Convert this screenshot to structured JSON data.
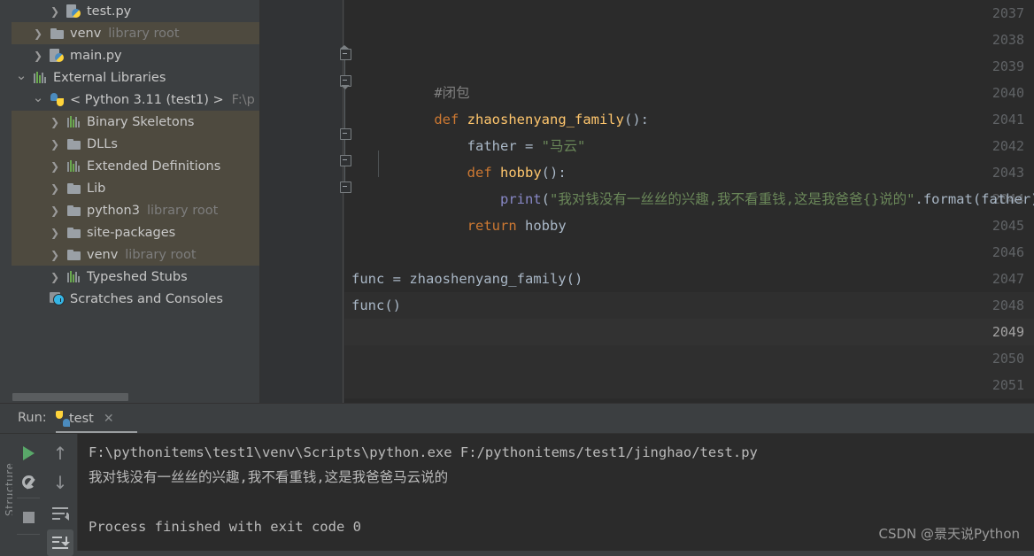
{
  "project_tree": {
    "rows": [
      {
        "label": "test.py",
        "sub": "",
        "icon": "python-file-icon",
        "arrow": "chevron-right",
        "indent": 3,
        "selected": false
      },
      {
        "label": "venv",
        "sub": "library root",
        "icon": "folder-icon",
        "arrow": "chevron-right",
        "indent": 2,
        "selected": true
      },
      {
        "label": "main.py",
        "sub": "",
        "icon": "python-file-icon",
        "arrow": "chevron-right",
        "indent": 2,
        "selected": false
      },
      {
        "label": "External Libraries",
        "sub": "",
        "icon": "library-icon",
        "arrow": "chevron-down",
        "indent": 1,
        "selected": false
      },
      {
        "label": "< Python 3.11 (test1) >",
        "sub": "",
        "path": "F:\\p",
        "icon": "python-icon",
        "arrow": "chevron-down",
        "indent": 2,
        "selected": false
      },
      {
        "label": "Binary Skeletons",
        "sub": "",
        "icon": "library-icon",
        "arrow": "chevron-right",
        "indent": 3,
        "selected": true
      },
      {
        "label": "DLLs",
        "sub": "",
        "icon": "folder-icon",
        "arrow": "chevron-right",
        "indent": 3,
        "selected": true
      },
      {
        "label": "Extended Definitions",
        "sub": "",
        "icon": "library-icon",
        "arrow": "chevron-right",
        "indent": 3,
        "selected": true
      },
      {
        "label": "Lib",
        "sub": "",
        "icon": "folder-icon",
        "arrow": "chevron-right",
        "indent": 3,
        "selected": true
      },
      {
        "label": "python3",
        "sub": "library root",
        "icon": "folder-icon",
        "arrow": "chevron-right",
        "indent": 3,
        "selected": true
      },
      {
        "label": "site-packages",
        "sub": "",
        "icon": "folder-icon",
        "arrow": "chevron-right",
        "indent": 3,
        "selected": true
      },
      {
        "label": "venv",
        "sub": "library root",
        "icon": "folder-icon",
        "arrow": "chevron-right",
        "indent": 3,
        "selected": true
      },
      {
        "label": "Typeshed Stubs",
        "sub": "",
        "icon": "library-icon",
        "arrow": "chevron-right",
        "indent": 3,
        "selected": false
      },
      {
        "label": "Scratches and Consoles",
        "sub": "",
        "icon": "scratches-icon",
        "arrow": "none",
        "indent": 2,
        "selected": false
      }
    ]
  },
  "editor": {
    "current_line": 2049,
    "lines": [
      {
        "num": 2037,
        "text": ""
      },
      {
        "num": 2038,
        "text": ""
      },
      {
        "num": 2039,
        "text": "#闭包"
      },
      {
        "num": 2040,
        "text": "def zhaoshenyang_family():"
      },
      {
        "num": 2041,
        "text": "    father = \"马云\""
      },
      {
        "num": 2042,
        "text": "    def hobby():"
      },
      {
        "num": 2043,
        "text": "        print(\"我对钱没有一丝丝的兴趣,我不看重钱,这是我爸爸{}说的\".format(father))"
      },
      {
        "num": 2044,
        "text": "    return hobby"
      },
      {
        "num": 2045,
        "text": ""
      },
      {
        "num": 2046,
        "text": ""
      },
      {
        "num": 2047,
        "text": "func = zhaoshenyang_family()"
      },
      {
        "num": 2048,
        "text": "func()"
      },
      {
        "num": 2049,
        "text": ""
      },
      {
        "num": 2050,
        "text": ""
      },
      {
        "num": 2051,
        "text": ""
      }
    ],
    "tokens": {
      "comment_2039": "#闭包",
      "kw_def": "def",
      "fn_zhaoshenyang": "zhaoshenyang_family",
      "var_father": "father",
      "str_mayun": "\"马云\"",
      "fn_hobby": "hobby",
      "fn_print": "print",
      "str_print": "\"我对钱没有一丝丝的兴趣,我不看重钱,这是我爸爸{}说的\"",
      "method_format": ".format(father))",
      "kw_return": "return",
      "name_hobby": "hobby",
      "line2047": "func = zhaoshenyang_family()",
      "line2048": "func()"
    }
  },
  "run_panel": {
    "label": "Run:",
    "tab_label": "test",
    "tab_close": "✕",
    "structure_label": "Structure",
    "toolbar": [
      {
        "name": "run-button",
        "icon": "play-icon"
      },
      {
        "name": "settings-button",
        "icon": "wrench-icon"
      },
      {
        "name": "stop-button",
        "icon": "stop-icon"
      },
      {
        "name": "previous-occurrence-button",
        "icon": "arrow-up-icon"
      },
      {
        "name": "next-occurrence-button",
        "icon": "arrow-down-icon"
      },
      {
        "name": "soft-wrap-button",
        "icon": "soft-wrap-icon"
      },
      {
        "name": "scroll-to-end-button",
        "icon": "scroll-to-end-icon"
      }
    ],
    "console_lines": [
      "F:\\pythonitems\\test1\\venv\\Scripts\\python.exe F:/pythonitems/test1/jinghao/test.py",
      "我对钱没有一丝丝的兴趣,我不看重钱,这是我爸爸马云说的",
      "",
      "Process finished with exit code 0"
    ]
  },
  "watermark": "CSDN @景天说Python",
  "colors": {
    "panel_bg": "#3c3f41",
    "editor_bg": "#2b2b2b",
    "gutter_bg": "#313335",
    "selection_olive": "#4e4a3f",
    "keyword": "#cc7832",
    "function": "#ffc66d",
    "string": "#6a8759",
    "print_builtin": "#8888c6",
    "text": "#a9b7c6",
    "comment": "#808080",
    "run_green": "#59a869",
    "current_line": "#323232"
  }
}
